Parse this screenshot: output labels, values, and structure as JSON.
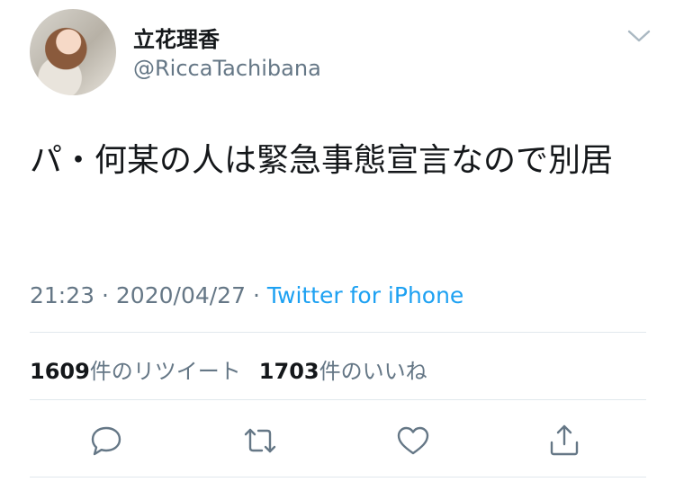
{
  "author": {
    "display_name": "立花理香",
    "handle": "@RiccaTachibana"
  },
  "tweet": {
    "text": "パ・何某の人は緊急事態宣言なので別居",
    "time": "21:23",
    "date": "2020/04/27",
    "separator": "·",
    "source": "Twitter for iPhone"
  },
  "stats": {
    "retweets_count": "1609",
    "retweets_label": "件のリツイート",
    "likes_count": "1703",
    "likes_label": "件のいいね"
  },
  "icons": {
    "caret": "chevron-down-icon",
    "reply": "reply-icon",
    "retweet": "retweet-icon",
    "like": "heart-icon",
    "share": "share-icon"
  },
  "colors": {
    "text": "#14171a",
    "secondary": "#657786",
    "link": "#1da1f2",
    "divider": "#e1e8ed"
  }
}
